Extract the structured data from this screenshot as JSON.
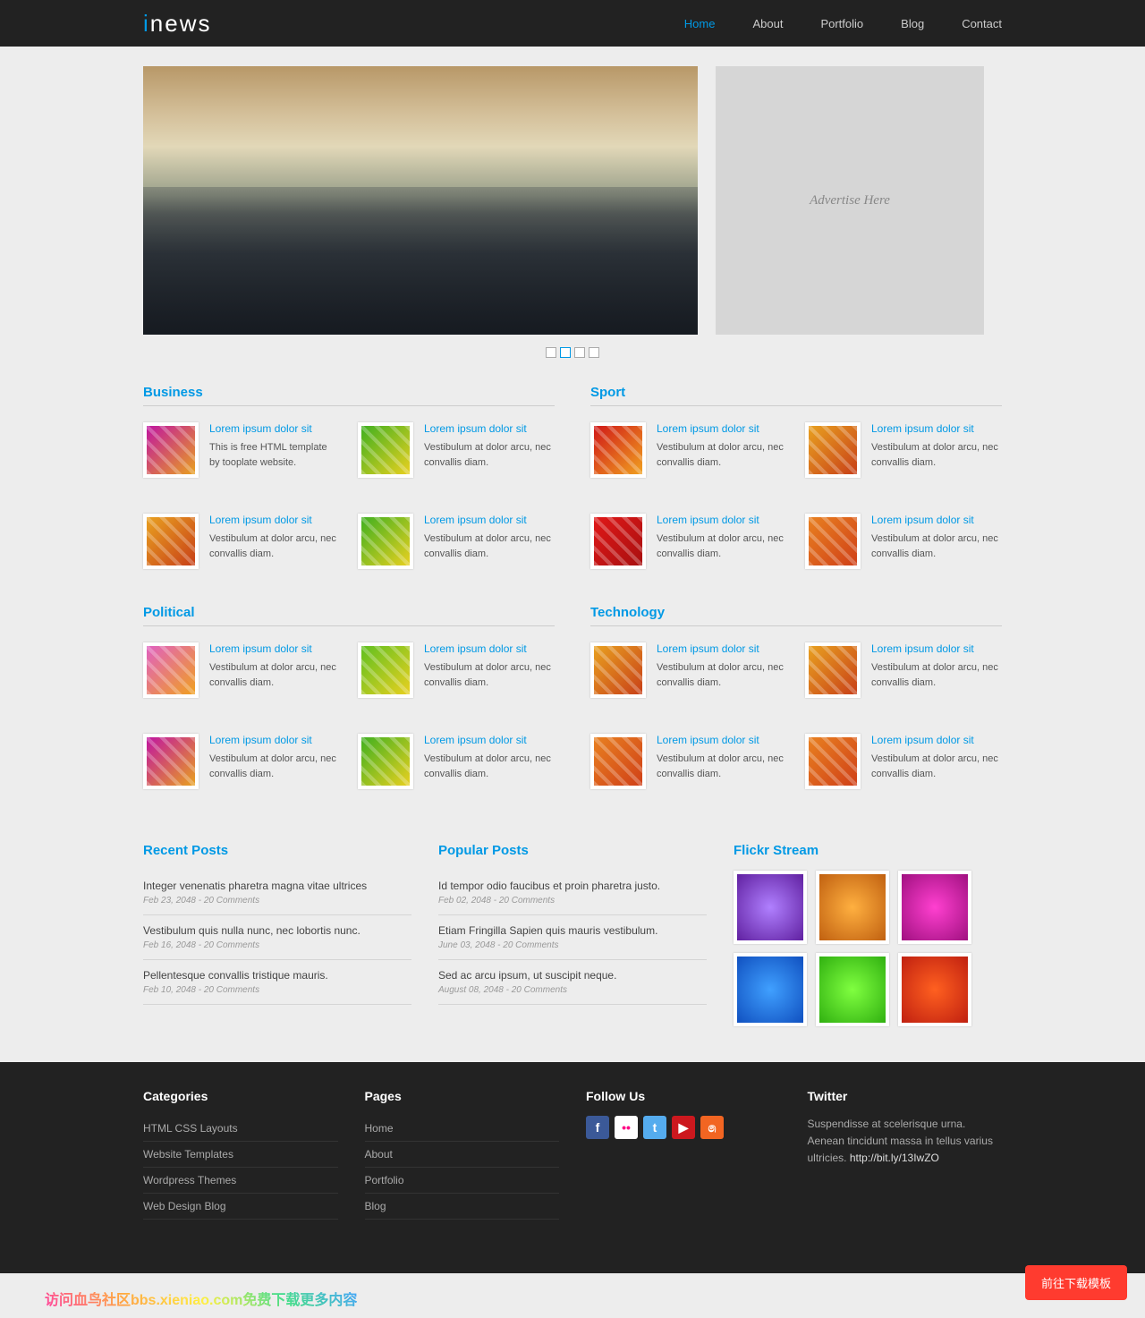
{
  "logo": {
    "prefix": "i",
    "text": "news"
  },
  "nav": [
    "Home",
    "About",
    "Portfolio",
    "Blog",
    "Contact"
  ],
  "nav_active": 0,
  "ad_text": "Advertise Here",
  "sections": [
    {
      "title": "Business",
      "items": [
        {
          "t": "Lorem ipsum dolor sit",
          "d": "This is free HTML template by tooplate website.",
          "c": "t1"
        },
        {
          "t": "Lorem ipsum dolor sit",
          "d": "Vestibulum at dolor arcu, nec convallis diam.",
          "c": "t2"
        },
        {
          "t": "Lorem ipsum dolor sit",
          "d": "Vestibulum at dolor arcu, nec convallis diam.",
          "c": "t4"
        },
        {
          "t": "Lorem ipsum dolor sit",
          "d": "Vestibulum at dolor arcu, nec convallis diam.",
          "c": "t2"
        }
      ]
    },
    {
      "title": "Sport",
      "items": [
        {
          "t": "Lorem ipsum dolor sit",
          "d": "Vestibulum at dolor arcu, nec convallis diam.",
          "c": "t3"
        },
        {
          "t": "Lorem ipsum dolor sit",
          "d": "Vestibulum at dolor arcu, nec convallis diam.",
          "c": "t4"
        },
        {
          "t": "Lorem ipsum dolor sit",
          "d": "Vestibulum at dolor arcu, nec convallis diam.",
          "c": "t6"
        },
        {
          "t": "Lorem ipsum dolor sit",
          "d": "Vestibulum at dolor arcu, nec convallis diam.",
          "c": "t5"
        }
      ]
    },
    {
      "title": "Political",
      "items": [
        {
          "t": "Lorem ipsum dolor sit",
          "d": "Vestibulum at dolor arcu, nec convallis diam.",
          "c": "t7"
        },
        {
          "t": "Lorem ipsum dolor sit",
          "d": "Vestibulum at dolor arcu, nec convallis diam.",
          "c": "t8"
        },
        {
          "t": "Lorem ipsum dolor sit",
          "d": "Vestibulum at dolor arcu, nec convallis diam.",
          "c": "t1"
        },
        {
          "t": "Lorem ipsum dolor sit",
          "d": "Vestibulum at dolor arcu, nec convallis diam.",
          "c": "t2"
        }
      ]
    },
    {
      "title": "Technology",
      "items": [
        {
          "t": "Lorem ipsum dolor sit",
          "d": "Vestibulum at dolor arcu, nec convallis diam.",
          "c": "t4"
        },
        {
          "t": "Lorem ipsum dolor sit",
          "d": "Vestibulum at dolor arcu, nec convallis diam.",
          "c": "t4"
        },
        {
          "t": "Lorem ipsum dolor sit",
          "d": "Vestibulum at dolor arcu, nec convallis diam.",
          "c": "t5"
        },
        {
          "t": "Lorem ipsum dolor sit",
          "d": "Vestibulum at dolor arcu, nec convallis diam.",
          "c": "t5"
        }
      ]
    }
  ],
  "recent": {
    "title": "Recent Posts",
    "items": [
      {
        "t": "Integer venenatis pharetra magna vitae ultrices",
        "m": "Feb 23, 2048 - 20 Comments"
      },
      {
        "t": "Vestibulum quis nulla nunc, nec lobortis nunc.",
        "m": "Feb 16, 2048 - 20 Comments"
      },
      {
        "t": "Pellentesque convallis tristique mauris.",
        "m": "Feb 10, 2048 - 20 Comments"
      }
    ]
  },
  "popular": {
    "title": "Popular Posts",
    "items": [
      {
        "t": "Id tempor odio faucibus et proin pharetra justo.",
        "m": "Feb 02, 2048 - 20 Comments"
      },
      {
        "t": "Etiam Fringilla Sapien quis mauris vestibulum.",
        "m": "June 03, 2048 - 20 Comments"
      },
      {
        "t": "Sed ac arcu ipsum, ut suscipit neque.",
        "m": "August 08, 2048 - 20 Comments"
      }
    ]
  },
  "flickr_title": "Flickr Stream",
  "footer": {
    "categories": {
      "title": "Categories",
      "items": [
        "HTML CSS Layouts",
        "Website Templates",
        "Wordpress Themes",
        "Web Design Blog"
      ]
    },
    "pages": {
      "title": "Pages",
      "items": [
        "Home",
        "About",
        "Portfolio",
        "Blog"
      ]
    },
    "follow_title": "Follow Us",
    "twitter": {
      "title": "Twitter",
      "text": "Suspendisse at scelerisque urna. Aenean tincidunt massa in tellus varius ultricies. ",
      "link": "http://bit.ly/13IwZO"
    }
  },
  "cta": "前往下载模板",
  "watermark": "访问血鸟社区bbs.xieniao.com免费下载更多内容"
}
